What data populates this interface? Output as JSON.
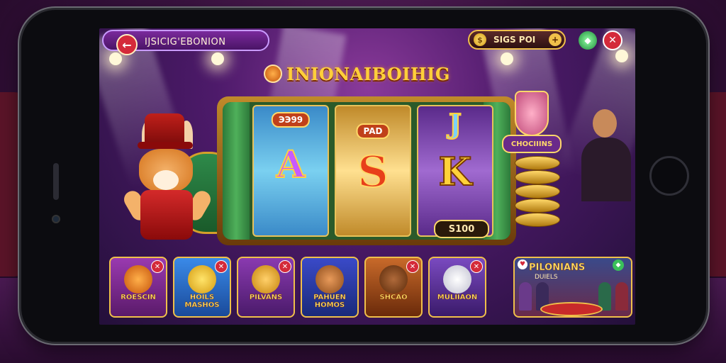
{
  "header": {
    "back_icon": "back-arrow-icon",
    "title": "IJSICIG'EBONION",
    "coins_label": "SIGS POI",
    "coin_icon": "coin-icon",
    "plus_icon": "plus-icon",
    "gem_icon": "gem-icon",
    "close_icon": "close-icon"
  },
  "logo": {
    "text": "INIONAIBOIHIG"
  },
  "slot": {
    "reel1_top": "ЭЭ99",
    "reel1_mid": "A",
    "reel2_top": "PAD",
    "reel2_mid": "S",
    "reel3_top": "J",
    "reel3_mid": "K",
    "bet_value": "S100"
  },
  "side_badge": "CHOCIIINS",
  "games": [
    {
      "title": "ROESCIN",
      "color": "#7a2a9c"
    },
    {
      "title": "HOILS MASHOS",
      "color": "#2a6ac8"
    },
    {
      "title": "PILVANS",
      "color": "#6a2a9c"
    },
    {
      "title": "PAHUEN HOMOS",
      "color": "#2a3a8a"
    },
    {
      "title": "SHCAO",
      "color": "#7a3a1a"
    },
    {
      "title": "MULIIAON",
      "color": "#4a2a7a"
    }
  ],
  "featured_game": {
    "title": "PILONIANS",
    "subtitle": "DUIELS"
  },
  "colors": {
    "accent_gold": "#f0c04a",
    "accent_red": "#d42a3a",
    "screen_purple": "#4d1a6a"
  }
}
